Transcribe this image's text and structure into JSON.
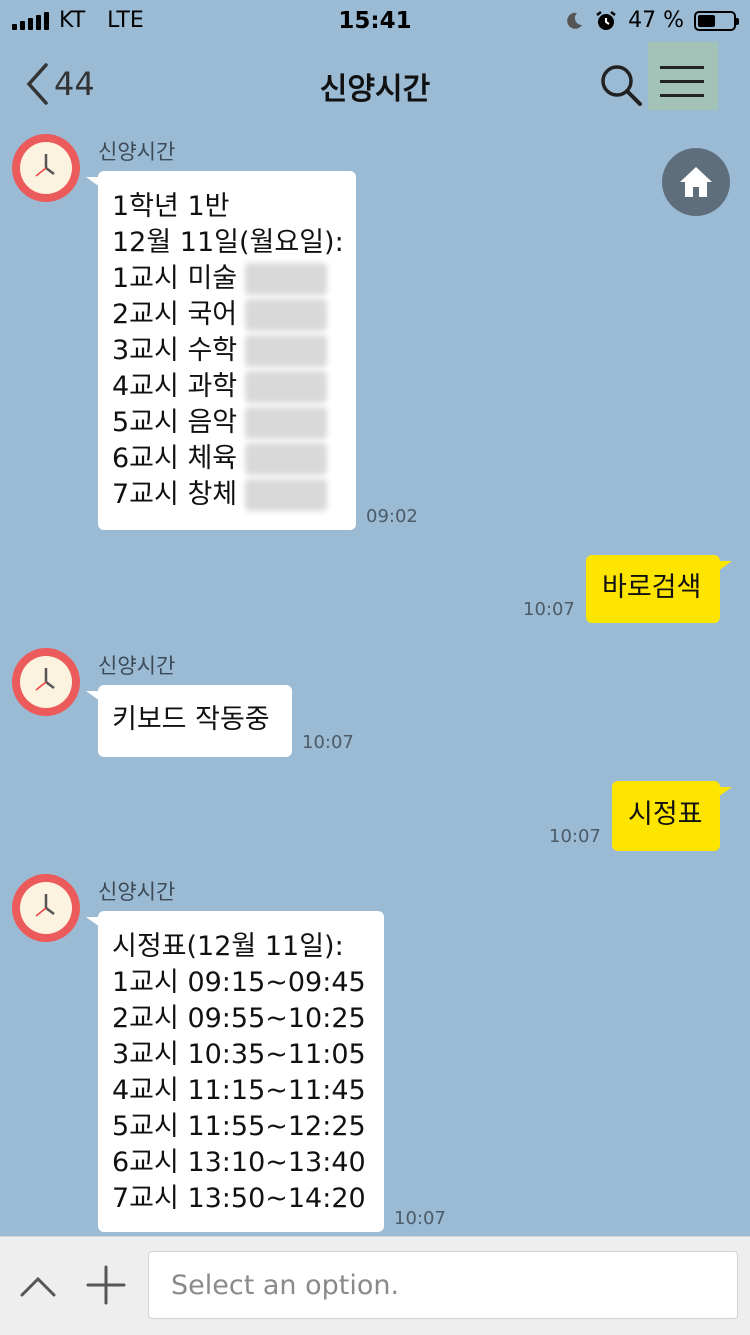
{
  "status_bar": {
    "carrier": "KT",
    "network": "LTE",
    "time": "15:41",
    "battery_percent": "47 %",
    "battery_level": 0.47
  },
  "header": {
    "back_count": "44",
    "title": "신양시간",
    "icons": [
      "chevron-left-icon",
      "search-icon",
      "menu-icon"
    ]
  },
  "home_icon": "home-icon",
  "messages": [
    {
      "direction": "incoming",
      "sender": "신양시간",
      "lines": [
        "1학년 1반",
        "12월 11일(월요일):",
        "1교시 미술",
        "2교시 국어",
        "3교시 수학",
        "4교시 과학",
        "5교시 음악",
        "6교시 체육",
        "7교시 창체"
      ],
      "time": "09:02"
    },
    {
      "direction": "outgoing",
      "text": "바로검색",
      "time": "10:07"
    },
    {
      "direction": "incoming",
      "sender": "신양시간",
      "lines": [
        "키보드 작동중"
      ],
      "time": "10:07"
    },
    {
      "direction": "outgoing",
      "text": "시정표",
      "time": "10:07"
    },
    {
      "direction": "incoming",
      "sender": "신양시간",
      "lines": [
        "시정표(12월 11일):",
        "1교시 09:15~09:45",
        "2교시 09:55~10:25",
        "3교시 10:35~11:05",
        "4교시 11:15~11:45",
        "5교시 11:55~12:25",
        "6교시 13:10~13:40",
        "7교시 13:50~14:20"
      ],
      "time": "10:07"
    }
  ],
  "input_bar": {
    "placeholder": "Select an option."
  },
  "colors": {
    "chat_background": "#9bbbd4",
    "outgoing_bubble": "#fee500",
    "incoming_bubble": "#ffffff",
    "avatar": "#ec5b5b",
    "home_button": "#5f6e7c"
  }
}
